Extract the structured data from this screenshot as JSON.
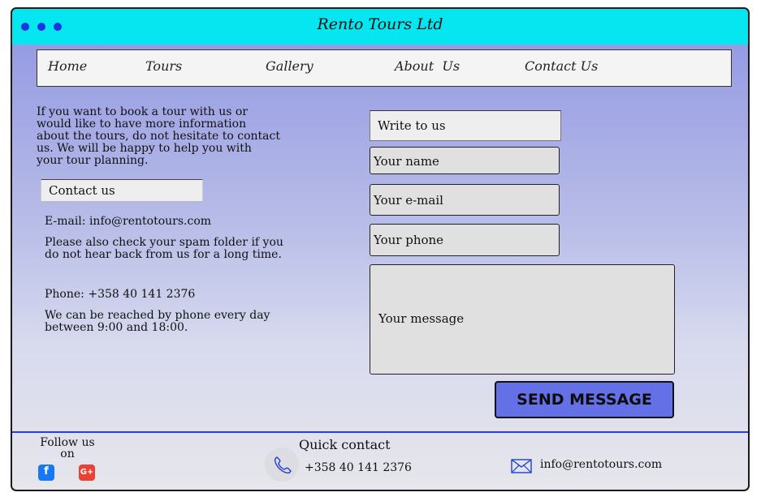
{
  "app": {
    "title": "Rento Tours Ltd"
  },
  "nav": {
    "items": [
      "Home",
      "Tours",
      "Gallery",
      "About  Us",
      "Contact Us"
    ]
  },
  "intro": "If you want to book a tour with us or would like to have more information about the tours, do not hesitate to contact us. We will be happy to help you with your tour planning.",
  "contact": {
    "heading": "Contact us",
    "email_line": "E-mail: info@rentotours.com",
    "email_note": "Please also check your spam folder if you do not hear back from us for a long time.",
    "phone_line": "Phone: +358 40 141 2376",
    "phone_note": "We can be reached by phone every day between 9:00 and 18:00."
  },
  "form": {
    "heading": "Write to us",
    "name_placeholder": "Your name",
    "email_placeholder": "Your e-mail",
    "phone_placeholder": "Your phone",
    "message_placeholder": "Your message",
    "send_label": "SEND MESSAGE"
  },
  "footer": {
    "follow_label": "Follow us on",
    "social": [
      "facebook-icon",
      "google-plus-icon"
    ],
    "quick_title": "Quick contact",
    "phone": "+358 40 141 2376",
    "email": "info@rentotours.com"
  },
  "colors": {
    "titlebar": "#05e6f0",
    "window_dots": "#1a36e0",
    "send_button": "#6470e6",
    "footer_line": "#2a3fd8",
    "facebook": "#1877f2",
    "google_plus": "#e94235"
  }
}
